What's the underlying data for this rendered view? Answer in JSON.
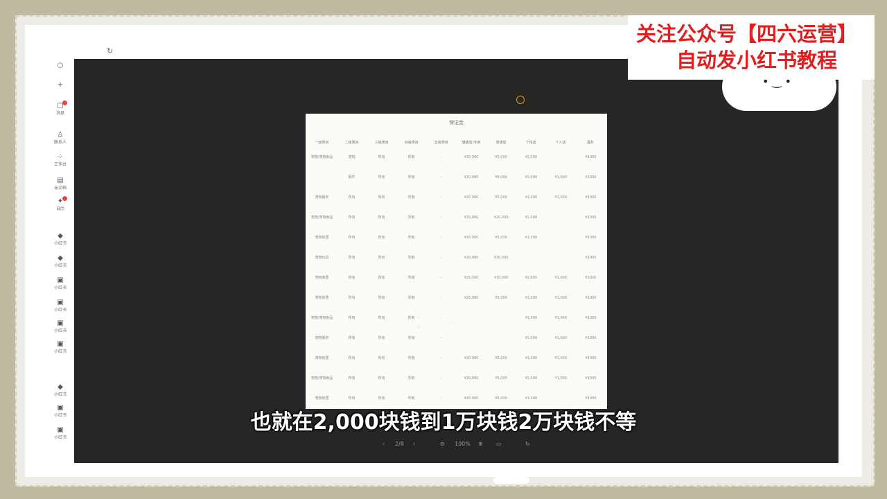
{
  "promo": {
    "line1": "关注公众号【四六运营】",
    "line2": "自动发小红书教程"
  },
  "subtitle": "也就在2,000块钱到1万块钱2万块钱不等",
  "document": {
    "title": "保证金",
    "headers": [
      "一级类目",
      "二级类目",
      "三级类目",
      "四级类目",
      "五级类目",
      "旗舰店/专卖",
      "普通店",
      "个体店",
      "个人店",
      "图片"
    ],
    "rows": [
      [
        "宠物/宠物食品",
        "宠物",
        "所有",
        "所有",
        "-",
        "¥20,000",
        "¥5,000",
        "¥2,000",
        "",
        "¥1000"
      ],
      [
        "",
        "配件",
        "所有",
        "所有",
        "-",
        "¥20,000",
        "¥5,000",
        "¥1,000",
        "¥1,000",
        "¥1000"
      ],
      [
        "宠物服务",
        "所有",
        "所有",
        "所有",
        "-",
        "¥20,000",
        "¥5,000",
        "¥1,000",
        "¥1,000",
        "¥1000"
      ],
      [
        "宠物/宠物食品",
        "所有",
        "所有",
        "所有",
        "-",
        "¥20,000",
        "¥20,000",
        "¥1,000",
        "",
        "¥1000"
      ],
      [
        "宠物家居",
        "所有",
        "所有",
        "所有",
        "-",
        "¥20,000",
        "¥5,000",
        "¥1,000",
        "",
        "¥1000"
      ],
      [
        "宠物玩具",
        "所有",
        "所有",
        "所有",
        "-",
        "¥20,000",
        "¥20,000",
        "",
        "",
        "¥1000"
      ],
      [
        "宠物家居",
        "所有",
        "所有",
        "所有",
        "-",
        "¥20,000",
        "¥20,000",
        "¥1,000",
        "¥1,000",
        "¥1000"
      ],
      [
        "宠物家居",
        "所有",
        "所有",
        "所有",
        "-",
        "¥20,000",
        "¥5,000",
        "¥1,000",
        "¥1,000",
        "¥1000"
      ],
      [
        "宠物/宠物食品",
        "所有",
        "所有",
        "所有",
        "-",
        "",
        "",
        "¥1,000",
        "¥1,000",
        "¥1000"
      ],
      [
        "宠物服务",
        "所有",
        "所有",
        "所有",
        "-",
        "",
        "",
        "¥1,000",
        "¥1,000",
        "¥1000"
      ],
      [
        "宠物家居",
        "所有",
        "所有",
        "所有",
        "-",
        "¥20,000",
        "¥5,000",
        "¥1,000",
        "¥1,000",
        "¥1000"
      ],
      [
        "宠物/宠物食品",
        "所有",
        "所有",
        "所有",
        "-",
        "¥20,000",
        "¥5,000",
        "¥1,000",
        "¥1,000",
        "¥1000"
      ],
      [
        "宠物家居",
        "所有",
        "所有",
        "所有",
        "-",
        "¥20,000",
        "¥5,000",
        "¥1,000",
        "",
        "¥1000"
      ]
    ]
  },
  "viewer_toolbar": {
    "prev": "‹",
    "page": "2/8",
    "next": "›",
    "zoom_out": "⊖",
    "zoom_level": "100%",
    "zoom_in": "⊕",
    "fit": "▭",
    "rotate": "↻"
  },
  "sidebar": {
    "items": [
      {
        "icon": "search-icon",
        "label": ""
      },
      {
        "icon": "plus-icon",
        "label": ""
      },
      {
        "icon": "message-icon",
        "label": "消息"
      },
      {
        "icon": "user-icon",
        "label": "联系人"
      },
      {
        "icon": "apps-icon",
        "label": "工作台"
      },
      {
        "icon": "doc-icon",
        "label": "云文档"
      },
      {
        "icon": "calendar-icon",
        "label": "日历"
      },
      {
        "icon": "note-icon",
        "label": "小红书"
      },
      {
        "icon": "note-icon",
        "label": "小红书"
      },
      {
        "icon": "note-icon",
        "label": "小红书"
      },
      {
        "icon": "note-icon",
        "label": "小红书"
      },
      {
        "icon": "note-icon",
        "label": "小红书"
      },
      {
        "icon": "note-icon",
        "label": "小红书"
      },
      {
        "icon": "note-icon",
        "label": "小红书"
      },
      {
        "icon": "note-icon",
        "label": "小红书"
      },
      {
        "icon": "note-icon",
        "label": "小红书"
      }
    ]
  }
}
